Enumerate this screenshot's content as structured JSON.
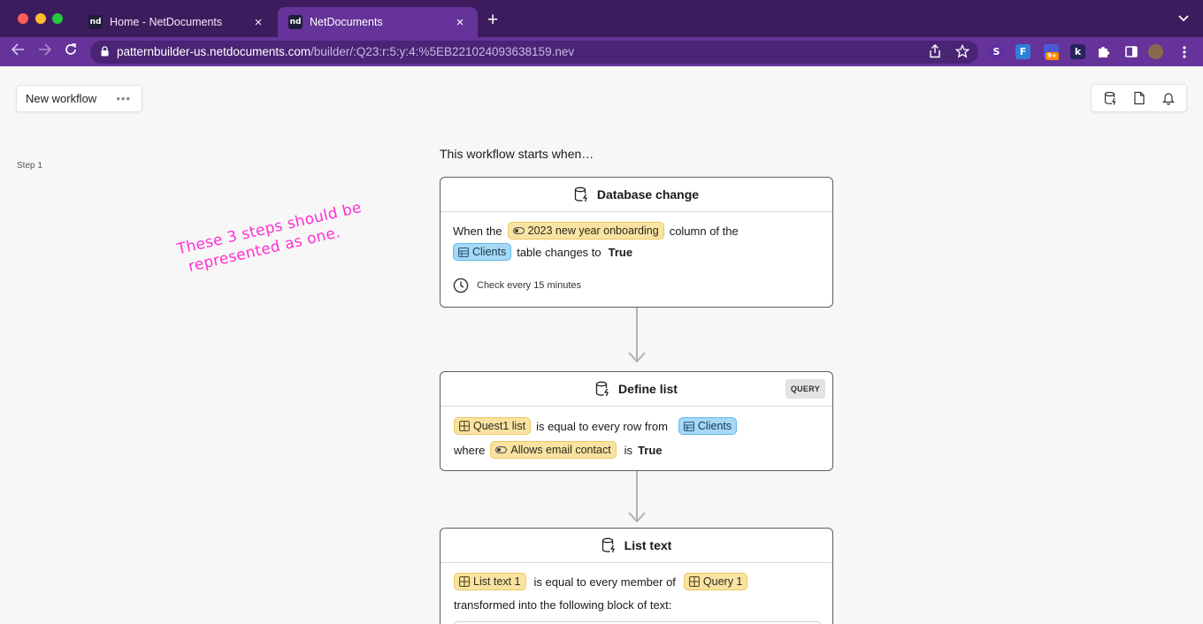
{
  "browser": {
    "tabs": [
      {
        "label": "Home - NetDocuments",
        "favicon": "nd"
      },
      {
        "label": "NetDocuments",
        "favicon": "nd"
      }
    ],
    "url_host": "patternbuilder-us.netdocuments.com",
    "url_path": "/builder/:Q23:r:5:y:4:%5EB221024093638159.nev"
  },
  "page": {
    "workflow_name": "New workflow",
    "workflow_menu": "•••",
    "step_label": "Step 1",
    "starts_text": "This workflow starts when…",
    "annotation_line1": "These 3 steps should be",
    "annotation_line2": "represented as one."
  },
  "cards": {
    "database_change": {
      "title": "Database change",
      "when_the": "When the",
      "column_chip": "2023 new year onboarding",
      "column_of_the": "column of the",
      "table_chip": "Clients",
      "table_changes_to": "table changes to",
      "value": "True",
      "check_interval": "Check every 15 minutes"
    },
    "define_list": {
      "title": "Define list",
      "badge": "QUERY",
      "list_chip": "Quest1 list",
      "equal_text": "is equal to every row from",
      "table_chip": "Clients",
      "where_text": "where",
      "field_chip": "Allows email contact",
      "is_text": "is",
      "value": "True"
    },
    "list_text": {
      "title": "List text",
      "chip1": "List text 1",
      "equal_text": "is equal to every member of",
      "chip2": "Query 1",
      "transform_text": "transformed into the following block of text:"
    }
  },
  "colors": {
    "tabbar": "#3d1c5e",
    "addressbar": "#653399",
    "annotation": "#ff2fd2",
    "chip_yellow": "#f9e3a3",
    "chip_blue": "#a6d9f6"
  }
}
